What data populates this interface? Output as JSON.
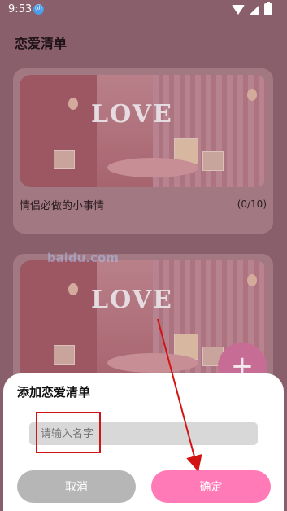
{
  "status": {
    "time": "9:53",
    "app_icon": "ⓓ",
    "icons": [
      "wifi-icon",
      "signal-icon",
      "battery-icon"
    ]
  },
  "page": {
    "title": "恋爱清单"
  },
  "cards": [
    {
      "label": "情侣必做的小事情",
      "count": "(0/10)"
    },
    {
      "label": "",
      "count": ""
    }
  ],
  "card_art_text": "LOVE",
  "watermark": "baidu.com",
  "fab_symbol": "+",
  "dialog": {
    "title": "添加恋爱清单",
    "input_placeholder": "请输入名字",
    "cancel": "取消",
    "confirm": "确定"
  },
  "colors": {
    "dimmed_background": "#8a5f6c",
    "confirm_button": "#ff7ab6",
    "cancel_button": "#b6b6b6",
    "annotation": "#d21414"
  }
}
